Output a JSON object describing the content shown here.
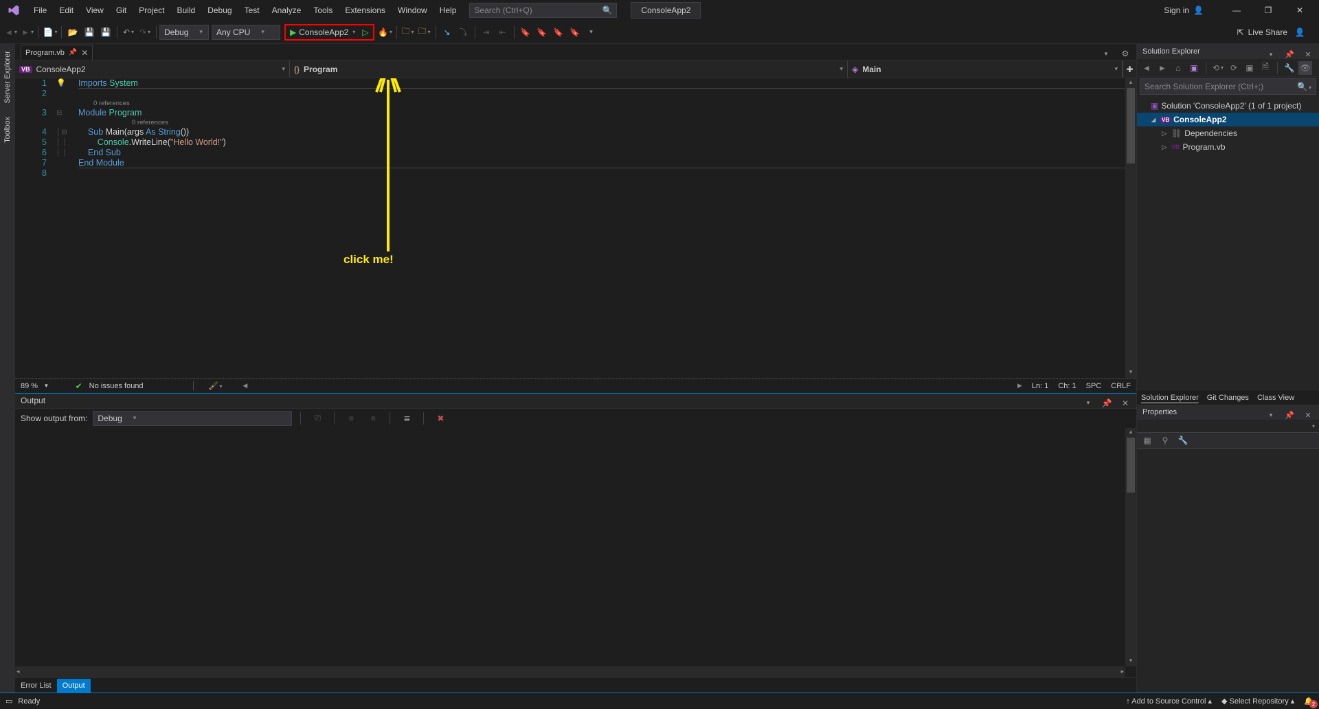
{
  "menubar": {
    "items": [
      "File",
      "Edit",
      "View",
      "Git",
      "Project",
      "Build",
      "Debug",
      "Test",
      "Analyze",
      "Tools",
      "Extensions",
      "Window",
      "Help"
    ],
    "search_placeholder": "Search (Ctrl+Q)",
    "solution_name": "ConsoleApp2",
    "signin": "Sign in"
  },
  "toolbar": {
    "config": "Debug",
    "platform": "Any CPU",
    "run_target": "ConsoleApp2",
    "liveshare": "Live Share"
  },
  "lefttools": {
    "tabs": [
      "Server Explorer",
      "Toolbox"
    ]
  },
  "doc_tab": {
    "title": "Program.vb"
  },
  "combos": {
    "project": "ConsoleApp2",
    "scope": "Program",
    "member": "Main"
  },
  "code": {
    "lines": [
      {
        "n": "1",
        "refs": null,
        "marg": "lamp",
        "segs": [
          {
            "c": "kw",
            "t": "Imports"
          },
          {
            "c": "",
            "t": " "
          },
          {
            "c": "type",
            "t": "System"
          }
        ]
      },
      {
        "n": "2",
        "refs": null,
        "marg": "",
        "segs": []
      },
      {
        "n": "3",
        "refs": "0 references",
        "marg": "box",
        "segs": [
          {
            "c": "kw",
            "t": "Module"
          },
          {
            "c": "",
            "t": " "
          },
          {
            "c": "type",
            "t": "Program"
          }
        ]
      },
      {
        "n": "4",
        "refs": "0 references",
        "marg": "boxline",
        "indent": "    ",
        "segs": [
          {
            "c": "kw",
            "t": "Sub"
          },
          {
            "c": "",
            "t": " Main("
          },
          {
            "c": "",
            "t": "args"
          },
          {
            "c": "",
            "t": " "
          },
          {
            "c": "kw",
            "t": "As"
          },
          {
            "c": "",
            "t": " "
          },
          {
            "c": "kw",
            "t": "String"
          },
          {
            "c": "",
            "t": "())"
          }
        ]
      },
      {
        "n": "5",
        "refs": null,
        "marg": "line",
        "indent": "        ",
        "segs": [
          {
            "c": "type",
            "t": "Console"
          },
          {
            "c": "",
            "t": ".WriteLine("
          },
          {
            "c": "str",
            "t": "\"Hello World!\""
          },
          {
            "c": "",
            "t": ")"
          }
        ]
      },
      {
        "n": "6",
        "refs": null,
        "marg": "line",
        "indent": "    ",
        "segs": [
          {
            "c": "kw",
            "t": "End"
          },
          {
            "c": "",
            "t": " "
          },
          {
            "c": "kw",
            "t": "Sub"
          }
        ]
      },
      {
        "n": "7",
        "refs": null,
        "marg": "",
        "segs": [
          {
            "c": "kw",
            "t": "End"
          },
          {
            "c": "",
            "t": " "
          },
          {
            "c": "kw",
            "t": "Module"
          }
        ]
      },
      {
        "n": "8",
        "refs": null,
        "marg": "",
        "segs": []
      }
    ]
  },
  "annotation": {
    "label": "click me!"
  },
  "editor_status": {
    "zoom": "89 %",
    "issues": "No issues found",
    "ln": "Ln: 1",
    "ch": "Ch: 1",
    "spc": "SPC",
    "eol": "CRLF"
  },
  "output": {
    "title": "Output",
    "show_label": "Show output from:",
    "show_value": "Debug",
    "bottom_tabs": [
      "Error List",
      "Output"
    ],
    "active_tab": 1
  },
  "solution_explorer": {
    "title": "Solution Explorer",
    "search_placeholder": "Search Solution Explorer (Ctrl+;)",
    "solution_label": "Solution 'ConsoleApp2' (1 of 1 project)",
    "project": "ConsoleApp2",
    "dependencies": "Dependencies",
    "file": "Program.vb",
    "panel_tabs": [
      "Solution Explorer",
      "Git Changes",
      "Class View"
    ]
  },
  "properties": {
    "title": "Properties"
  },
  "statusbar": {
    "ready": "Ready",
    "add_scm": "Add to Source Control",
    "select_repo": "Select Repository",
    "bell_count": "2"
  }
}
